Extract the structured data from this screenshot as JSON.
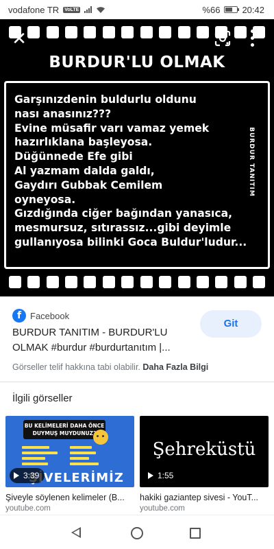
{
  "status_bar": {
    "carrier": "vodafone TR",
    "volte": "VoLTE",
    "battery": "%66",
    "battery_level": 0.66,
    "time": "20:42"
  },
  "viewer": {
    "icons": {
      "close": "close-icon",
      "lens": "lens-icon",
      "more": "more-vert-icon"
    },
    "image": {
      "title": "BURDUR'LU OLMAK",
      "side_label": "BURDUR TANITIM",
      "lines": [
        "Garşınızdenin buldurlu oldunu",
        "nası anasınız???",
        "Evine müsafir varı vamaz yemek",
        "hazırlıklana başleyosa.",
        "Düğünnede Efe gibi",
        "Al yazmam dalda galdı,",
        "Gaydırı Gubbak Cemilem",
        "oyneyosa.",
        "Gızdığında ciğer bağından yanasıca,",
        "mesmursuz, sıtırassız...gibi deyimle",
        "gullanıyosa bilinki Goca Buldur'ludur..."
      ]
    }
  },
  "result": {
    "source": "Facebook",
    "source_icon": "facebook-icon",
    "visit_label": "Git",
    "title": "BURDUR TANITIM - BURDUR'LU OLMAK #burdur #burdurtanıtım |...",
    "copyright_notice": "Görseller telif hakkına tabi olabilir.",
    "more_info": "Daha Fazla Bilgi"
  },
  "related": {
    "heading": "İlgili görseller",
    "items": [
      {
        "thumb_heading": "BU KELİMELERİ DAHA ÖNCE DUYMUŞ MUYDUNUZ?",
        "thumb_banner": "ŞİVELERİMİZ",
        "duration": "3:39",
        "title": "Şiveyle söylenen kelimeler (B...",
        "site": "youtube.com"
      },
      {
        "thumb_text": "Şehreküstü",
        "duration": "1:55",
        "title": "hakiki gaziantep sivesi - YouT...",
        "site": "youtube.com"
      }
    ]
  },
  "nav_bar": {
    "back": "back-icon",
    "home": "home-icon",
    "recents": "recents-icon"
  }
}
